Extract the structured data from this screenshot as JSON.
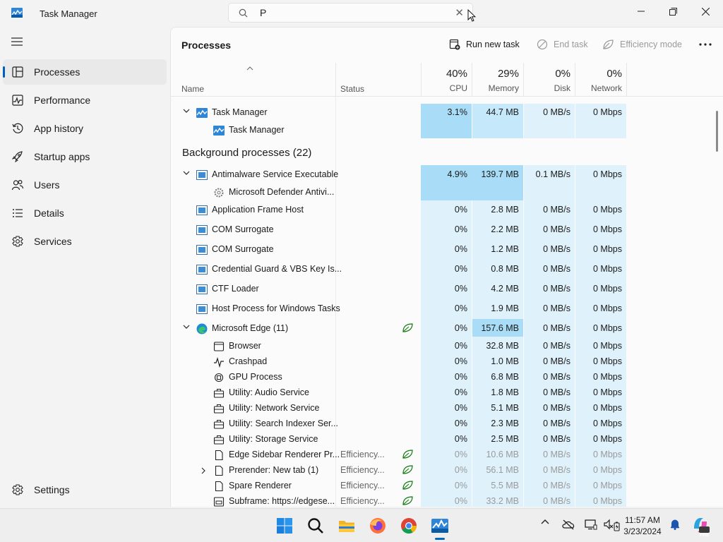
{
  "app": {
    "title": "Task Manager"
  },
  "search": {
    "value": "P",
    "clear_icon": "close-icon"
  },
  "window_controls": [
    "minimize-icon",
    "maximize-icon",
    "close-icon"
  ],
  "sidebar": {
    "items": [
      {
        "label": "Processes",
        "icon": "processes-icon",
        "active": true
      },
      {
        "label": "Performance",
        "icon": "performance-icon"
      },
      {
        "label": "App history",
        "icon": "history-icon"
      },
      {
        "label": "Startup apps",
        "icon": "startup-icon"
      },
      {
        "label": "Users",
        "icon": "users-icon"
      },
      {
        "label": "Details",
        "icon": "details-icon"
      },
      {
        "label": "Services",
        "icon": "services-icon"
      }
    ],
    "settings_label": "Settings"
  },
  "main": {
    "title": "Processes",
    "commands": {
      "run_new_task": "Run new task",
      "end_task": "End task",
      "efficiency_mode": "Efficiency mode"
    },
    "columns": {
      "name": "Name",
      "status": "Status",
      "cpu": {
        "pct": "40%",
        "label": "CPU"
      },
      "memory": {
        "pct": "29%",
        "label": "Memory"
      },
      "disk": {
        "pct": "0%",
        "label": "Disk"
      },
      "network": {
        "pct": "0%",
        "label": "Network"
      }
    },
    "group_label": "Background processes (22)",
    "rows": [
      {
        "name": "Task Manager",
        "cpu": "3.1%",
        "memory": "44.7 MB",
        "disk": "0 MB/s",
        "network": "0 Mbps"
      },
      {
        "name": "Task Manager"
      },
      {
        "name": "Antimalware Service Executable",
        "cpu": "4.9%",
        "memory": "139.7 MB",
        "disk": "0.1 MB/s",
        "network": "0 Mbps"
      },
      {
        "name": "Microsoft Defender Antivi..."
      },
      {
        "name": "Application Frame Host",
        "cpu": "0%",
        "memory": "2.8 MB",
        "disk": "0 MB/s",
        "network": "0 Mbps"
      },
      {
        "name": "COM Surrogate",
        "cpu": "0%",
        "memory": "2.2 MB",
        "disk": "0 MB/s",
        "network": "0 Mbps"
      },
      {
        "name": "COM Surrogate",
        "cpu": "0%",
        "memory": "1.2 MB",
        "disk": "0 MB/s",
        "network": "0 Mbps"
      },
      {
        "name": "Credential Guard & VBS Key Is...",
        "cpu": "0%",
        "memory": "0.8 MB",
        "disk": "0 MB/s",
        "network": "0 Mbps"
      },
      {
        "name": "CTF Loader",
        "cpu": "0%",
        "memory": "4.2 MB",
        "disk": "0 MB/s",
        "network": "0 Mbps"
      },
      {
        "name": "Host Process for Windows Tasks",
        "cpu": "0%",
        "memory": "1.9 MB",
        "disk": "0 MB/s",
        "network": "0 Mbps"
      },
      {
        "name": "Microsoft Edge (11)",
        "cpu": "0%",
        "memory": "157.6 MB",
        "disk": "0 MB/s",
        "network": "0 Mbps"
      },
      {
        "name": "Browser",
        "cpu": "0%",
        "memory": "32.8 MB",
        "disk": "0 MB/s",
        "network": "0 Mbps"
      },
      {
        "name": "Crashpad",
        "cpu": "0%",
        "memory": "1.0 MB",
        "disk": "0 MB/s",
        "network": "0 Mbps"
      },
      {
        "name": "GPU Process",
        "cpu": "0%",
        "memory": "6.8 MB",
        "disk": "0 MB/s",
        "network": "0 Mbps"
      },
      {
        "name": "Utility: Audio Service",
        "cpu": "0%",
        "memory": "1.8 MB",
        "disk": "0 MB/s",
        "network": "0 Mbps"
      },
      {
        "name": "Utility: Network Service",
        "cpu": "0%",
        "memory": "5.1 MB",
        "disk": "0 MB/s",
        "network": "0 Mbps"
      },
      {
        "name": "Utility: Search Indexer Ser...",
        "cpu": "0%",
        "memory": "2.3 MB",
        "disk": "0 MB/s",
        "network": "0 Mbps"
      },
      {
        "name": "Utility: Storage Service",
        "cpu": "0%",
        "memory": "2.5 MB",
        "disk": "0 MB/s",
        "network": "0 Mbps"
      },
      {
        "name": "Edge Sidebar Renderer Pr...",
        "status": "Efficiency...",
        "cpu": "0%",
        "memory": "10.6 MB",
        "disk": "0 MB/s",
        "network": "0 Mbps"
      },
      {
        "name": "Prerender: New tab (1)",
        "status": "Efficiency...",
        "cpu": "0%",
        "memory": "56.1 MB",
        "disk": "0 MB/s",
        "network": "0 Mbps"
      },
      {
        "name": "Spare Renderer",
        "status": "Efficiency...",
        "cpu": "0%",
        "memory": "5.5 MB",
        "disk": "0 MB/s",
        "network": "0 Mbps"
      },
      {
        "name": "Subframe: https://edgese...",
        "status": "Efficiency...",
        "cpu": "0%",
        "memory": "33.2 MB",
        "disk": "0 MB/s",
        "network": "0 Mbps"
      }
    ]
  },
  "taskbar": {
    "apps": [
      "start-icon",
      "search-icon",
      "file-explorer-icon",
      "firefox-icon",
      "chrome-icon",
      "task-manager-icon"
    ],
    "tray": [
      "chevron-up-icon",
      "onedrive-icon",
      "display-icon",
      "speaker-icon",
      "battery-icon",
      "bell-icon",
      "copilot-icon"
    ],
    "time": "11:57 AM",
    "date": "3/23/2024",
    "copilot_badge": "PRE"
  },
  "colors": {
    "accent": "#005fb8",
    "heat_light": "#dff1fb",
    "heat_mid": "#c5e8fa",
    "heat_strong": "#a9dcf6"
  }
}
